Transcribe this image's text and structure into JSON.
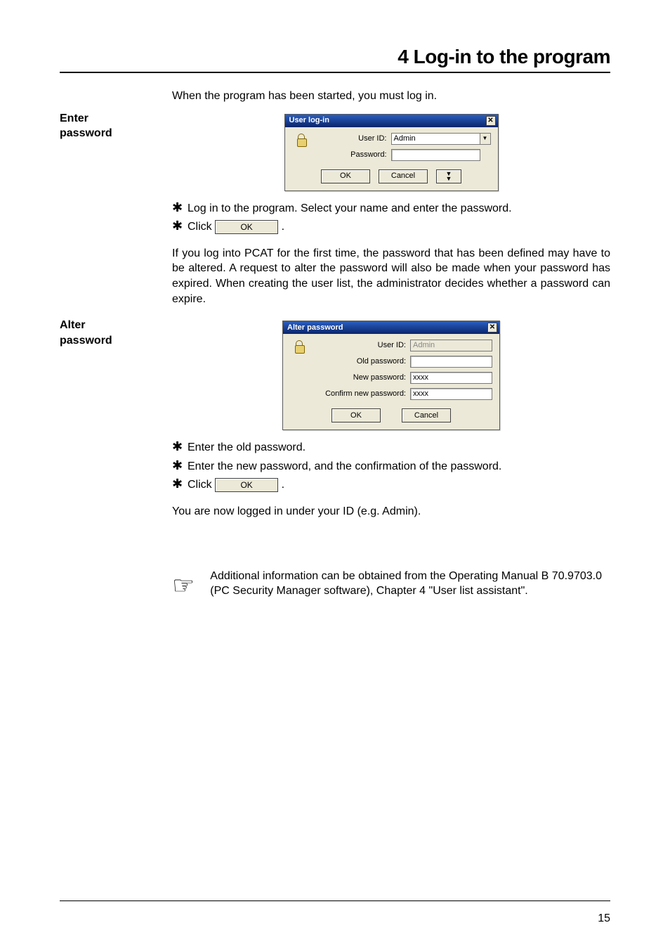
{
  "page": {
    "title": "4 Log-in to the program",
    "number": "15"
  },
  "p1": "When the program has been started, you must log in.",
  "side1": "Enter\npassword",
  "side2": "Alter\npassword",
  "dialog1": {
    "title": "User log-in",
    "userid_label": "User ID:",
    "userid_value": "Admin",
    "password_label": "Password:",
    "ok": "OK",
    "cancel": "Cancel"
  },
  "step1": "Log in to the program. Select your name and enter the password.",
  "step2_pre": "Click",
  "step2_btn": "OK",
  "step2_post": ".",
  "p2": "If you log into PCAT for the first time, the password that has been defined may have to be altered. A request to alter the password will also be made when your password has expired. When creating the user list, the administrator decides whether a password can expire.",
  "dialog2": {
    "title": "Alter password",
    "userid_label": "User ID:",
    "userid_value": "Admin",
    "oldpw_label": "Old password:",
    "newpw_label": "New password:",
    "newpw_value": "xxxx",
    "confirmpw_label": "Confirm new password:",
    "confirmpw_value": "xxxx",
    "ok": "OK",
    "cancel": "Cancel"
  },
  "step3": "Enter the old password.",
  "step4": "Enter the new password, and the confirmation of the password.",
  "step5_pre": "Click",
  "step5_btn": "OK",
  "step5_post": ".",
  "p3": "You are now logged in under your ID (e.g. Admin).",
  "footnote": "Additional information can be obtained from the Operating Manual B 70.9703.0 (PC Security Manager software),  Chapter 4 \"User list assistant\"."
}
